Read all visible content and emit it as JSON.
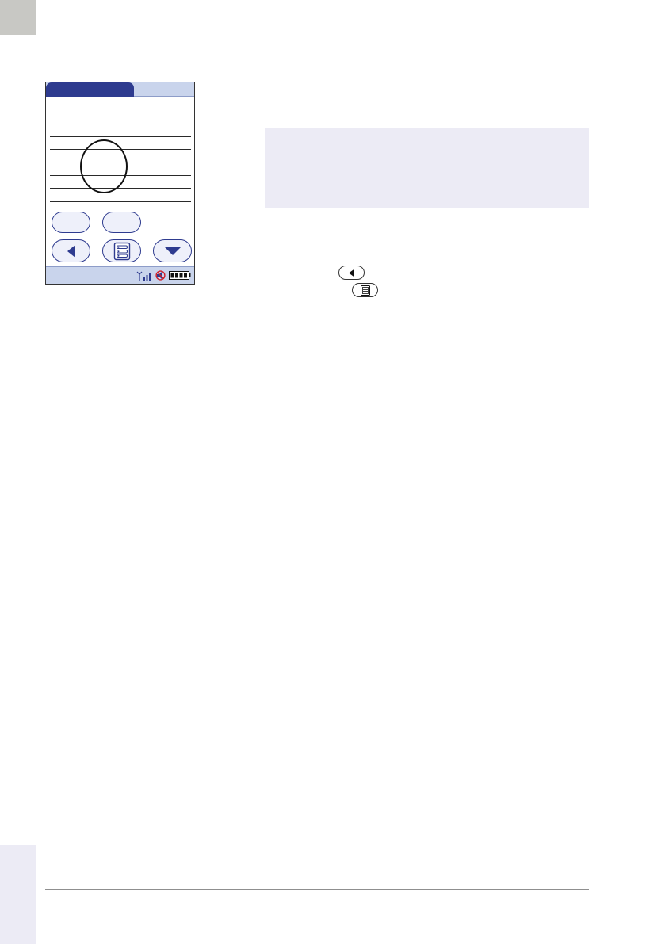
{
  "page": {
    "page_number": "",
    "colors": {
      "accent": "#2e3b8f",
      "screen_bar": "#c9d4ec",
      "note_background": "#ecebf5",
      "corner_tab": "#c8c8c4"
    }
  },
  "device_screen": {
    "nav_buttons": [
      {
        "icon": "triangle-left-icon"
      },
      {
        "icon": "menu-list-icon"
      },
      {
        "icon": "triangle-down-icon"
      }
    ],
    "status_icons": [
      "antenna-signal-icon",
      "no-sound-icon",
      "battery-icon"
    ]
  },
  "inline_icons": [
    "triangle-left-icon",
    "menu-list-icon"
  ]
}
